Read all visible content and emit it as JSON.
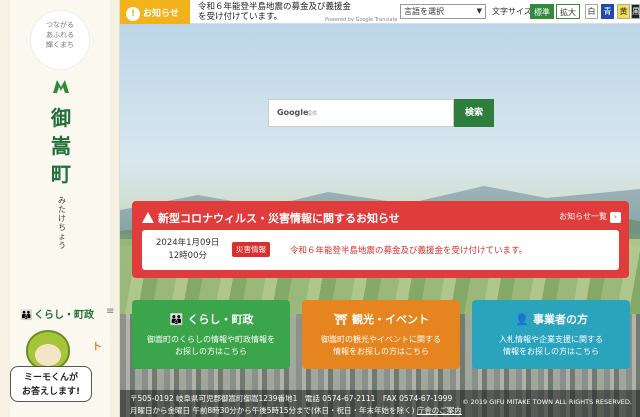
{
  "sidebar": {
    "tagline": [
      "つながる",
      "あふれる",
      "輝くまち"
    ],
    "town_name": [
      "御",
      "嵩",
      "町"
    ],
    "town_kana": [
      "み",
      "た",
      "け",
      "ち",
      "ょ",
      "う"
    ],
    "link_life": "くらし・町政",
    "mascot_speech": [
      "ミーモくんが",
      "お答えします!"
    ],
    "partial_text": "ト"
  },
  "topbar": {
    "notice_label": "お知らせ",
    "notice_text": "令和６年能登半島地震の募金及び義援金を受け付けています。",
    "google_translate": "Powered by Google Translate",
    "lang_select": "言語を選択",
    "font_size_label": "文字サイズ",
    "size_standard": "標準",
    "size_large": "拡大",
    "color_white": "白",
    "color_blue": "青",
    "color_yellow": "黄",
    "color_black": "黒"
  },
  "search": {
    "google_label": "Google",
    "provided": "提供",
    "button": "検索"
  },
  "alert": {
    "title": "新型コロナウィルス・災害情報に関するお知らせ",
    "list_link": "お知らせ一覧",
    "date": "2024年1月09日",
    "time": "12時00分",
    "badge": "災害情報",
    "message": "令和６年能登半島地震の募金及び義援金を受け付けています。"
  },
  "cards": {
    "life": {
      "title": "くらし・町政",
      "desc1": "御嵩町のくらしの情報や町政情報を",
      "desc2": "お探しの方はこちら"
    },
    "tour": {
      "title": "観光・イベント",
      "desc1": "御嵩町の観光やイベントに関する",
      "desc2": "情報をお探しの方はこちら"
    },
    "biz": {
      "title": "事業者の方",
      "desc1": "入札情報や企業支援に関する",
      "desc2": "情報をお探しの方はこちら"
    }
  },
  "footer": {
    "address": "〒505-0192 岐阜県可児郡御嵩町御嵩1239番地1　電話 0574-67-2111　FAX 0574-67-1999",
    "hours": "月曜日から金曜日 午前8時30分から午後5時15分まで(休日・祝日・年末年始を除く)",
    "office_link": "庁舎のご案内",
    "copyright": "© 2019 GIFU MITAKE TOWN ALL RIGHTS RESERVED."
  },
  "colors": {
    "green": "#2f7d3b",
    "alert_red": "#e03c3c",
    "notice_yellow": "#f2b21b",
    "card_orange": "#e6851f",
    "card_blue": "#2aa3bd"
  }
}
